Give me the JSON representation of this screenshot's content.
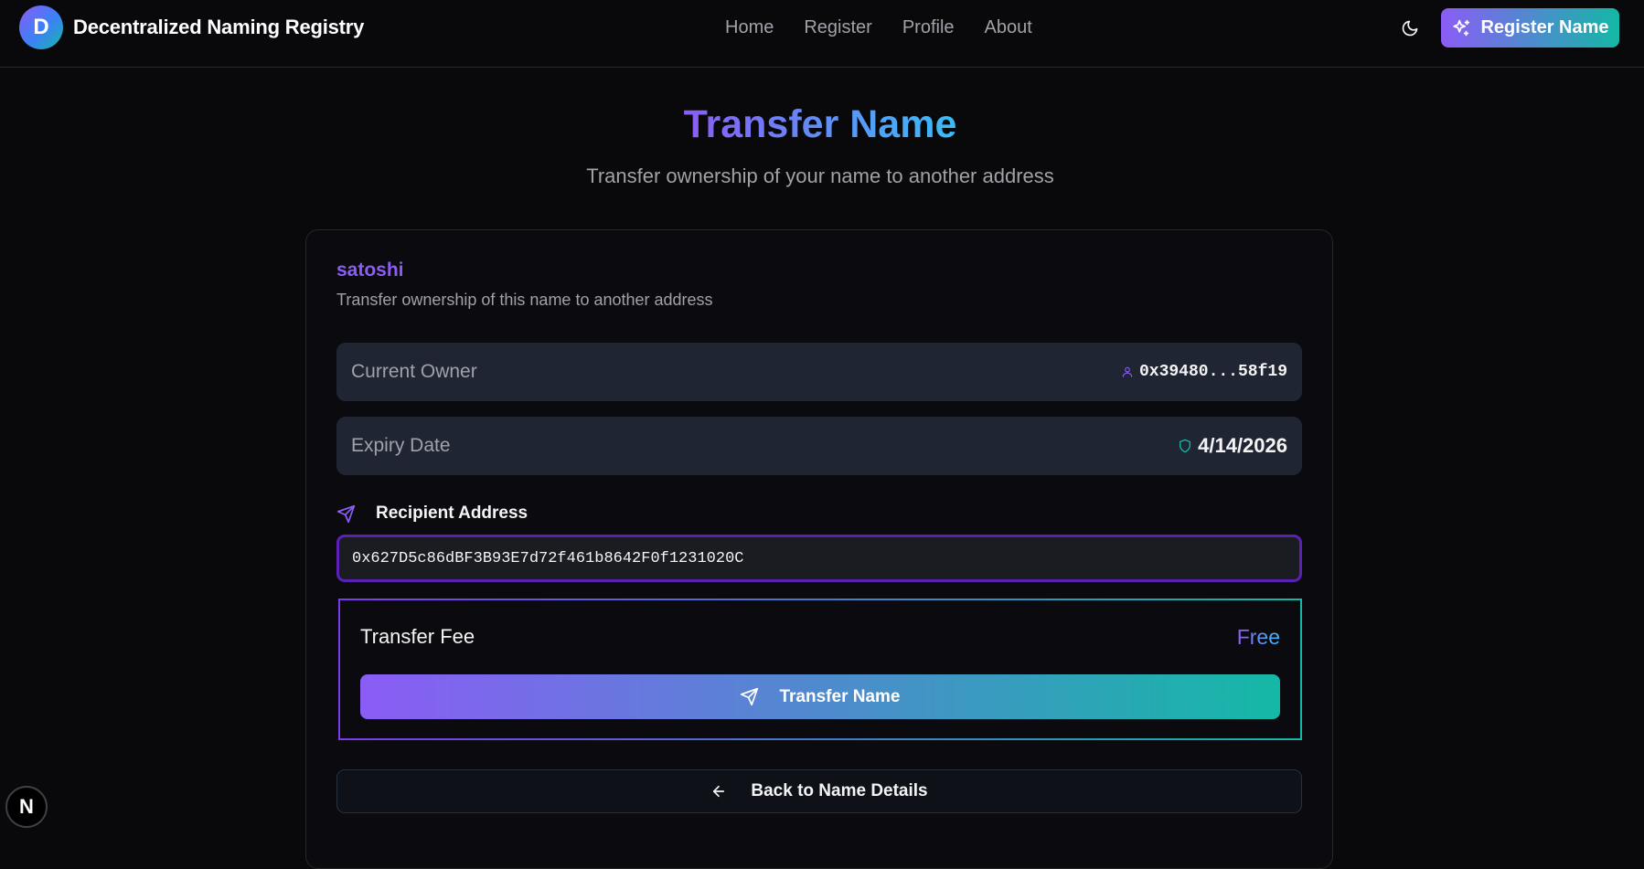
{
  "app": {
    "logo_letter": "D",
    "brand_name": "Decentralized Naming Registry"
  },
  "nav": {
    "links": [
      "Home",
      "Register",
      "Profile",
      "About"
    ],
    "theme_icon": "moon-icon",
    "register_button": "Register Name",
    "register_icon": "sparkles-icon"
  },
  "page": {
    "title": "Transfer Name",
    "subtitle": "Transfer ownership of your name to another address"
  },
  "card": {
    "name": "satoshi",
    "description": "Transfer ownership of this name to another address",
    "current_owner": {
      "label": "Current Owner",
      "value": "0x39480...58f19",
      "icon": "user-icon"
    },
    "expiry": {
      "label": "Expiry Date",
      "value": "4/14/2026",
      "icon": "shield-icon"
    },
    "recipient": {
      "label": "Recipient Address",
      "icon": "send-icon",
      "value": "0x627D5c86dBF3B93E7d72f461b8642F0f1231020C"
    },
    "fee": {
      "label": "Transfer Fee",
      "value": "Free"
    },
    "transfer_button": "Transfer Name",
    "back_button": "Back to Name Details"
  },
  "dev_badge": {
    "letter": "N"
  },
  "colors": {
    "accent_purple": "#8b5cf6",
    "accent_teal": "#14b8a6",
    "background": "#09090b",
    "panel": "#1f2532"
  }
}
